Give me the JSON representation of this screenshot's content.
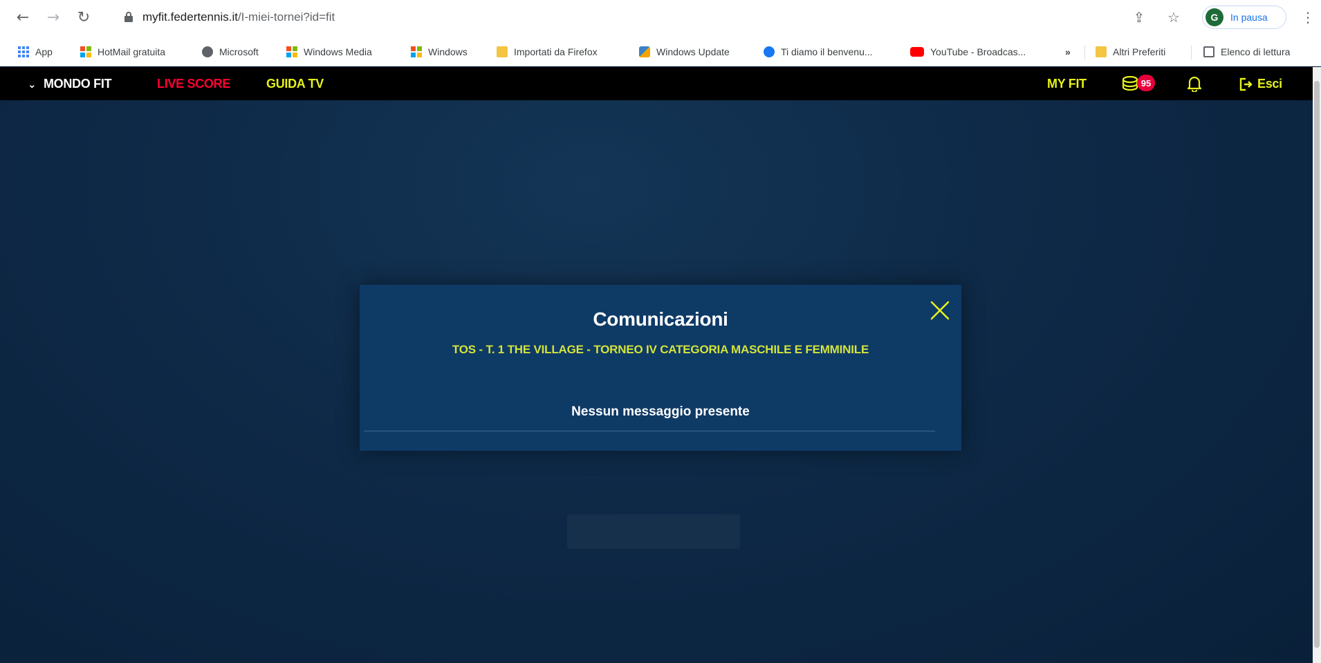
{
  "browser": {
    "url_host": "myfit.federtennis.it",
    "url_path": "/I-miei-tornei?id=fit",
    "profile_initial": "G",
    "profile_status": "In pausa",
    "bookmarks": [
      {
        "label": "App",
        "icon": "apps-grid-icon"
      },
      {
        "label": "HotMail gratuita",
        "icon": "windows-logo-icon"
      },
      {
        "label": "Microsoft",
        "icon": "globe-icon"
      },
      {
        "label": "Windows Media",
        "icon": "windows-logo-icon"
      },
      {
        "label": "Windows",
        "icon": "windows-logo-icon"
      },
      {
        "label": "Importati da Firefox",
        "icon": "folder-icon"
      },
      {
        "label": "Windows Update",
        "icon": "windows-update-icon"
      },
      {
        "label": "Ti diamo il benvenu...",
        "icon": "facebook-icon"
      },
      {
        "label": "YouTube - Broadcas...",
        "icon": "youtube-icon"
      }
    ],
    "bookmarks_overflow": "»",
    "other_bookmarks": "Altri Preferiti",
    "reading_list": "Elenco di lettura"
  },
  "header": {
    "mondo_fit": "MONDO FIT",
    "live_score": "LIVE SCORE",
    "guida_tv": "GUIDA TV",
    "my_fit": "MY FIT",
    "coins_badge": "95",
    "logout": "Esci",
    "colors": {
      "live_score": "#ff0033",
      "accent": "#e6f21a"
    }
  },
  "modal": {
    "title": "Comunicazioni",
    "subtitle": "TOS - T. 1 THE VILLAGE - TORNEO IV CATEGORIA MASCHILE E FEMMINILE",
    "message": "Nessun messaggio presente",
    "accent_color": "#d4e43a"
  }
}
